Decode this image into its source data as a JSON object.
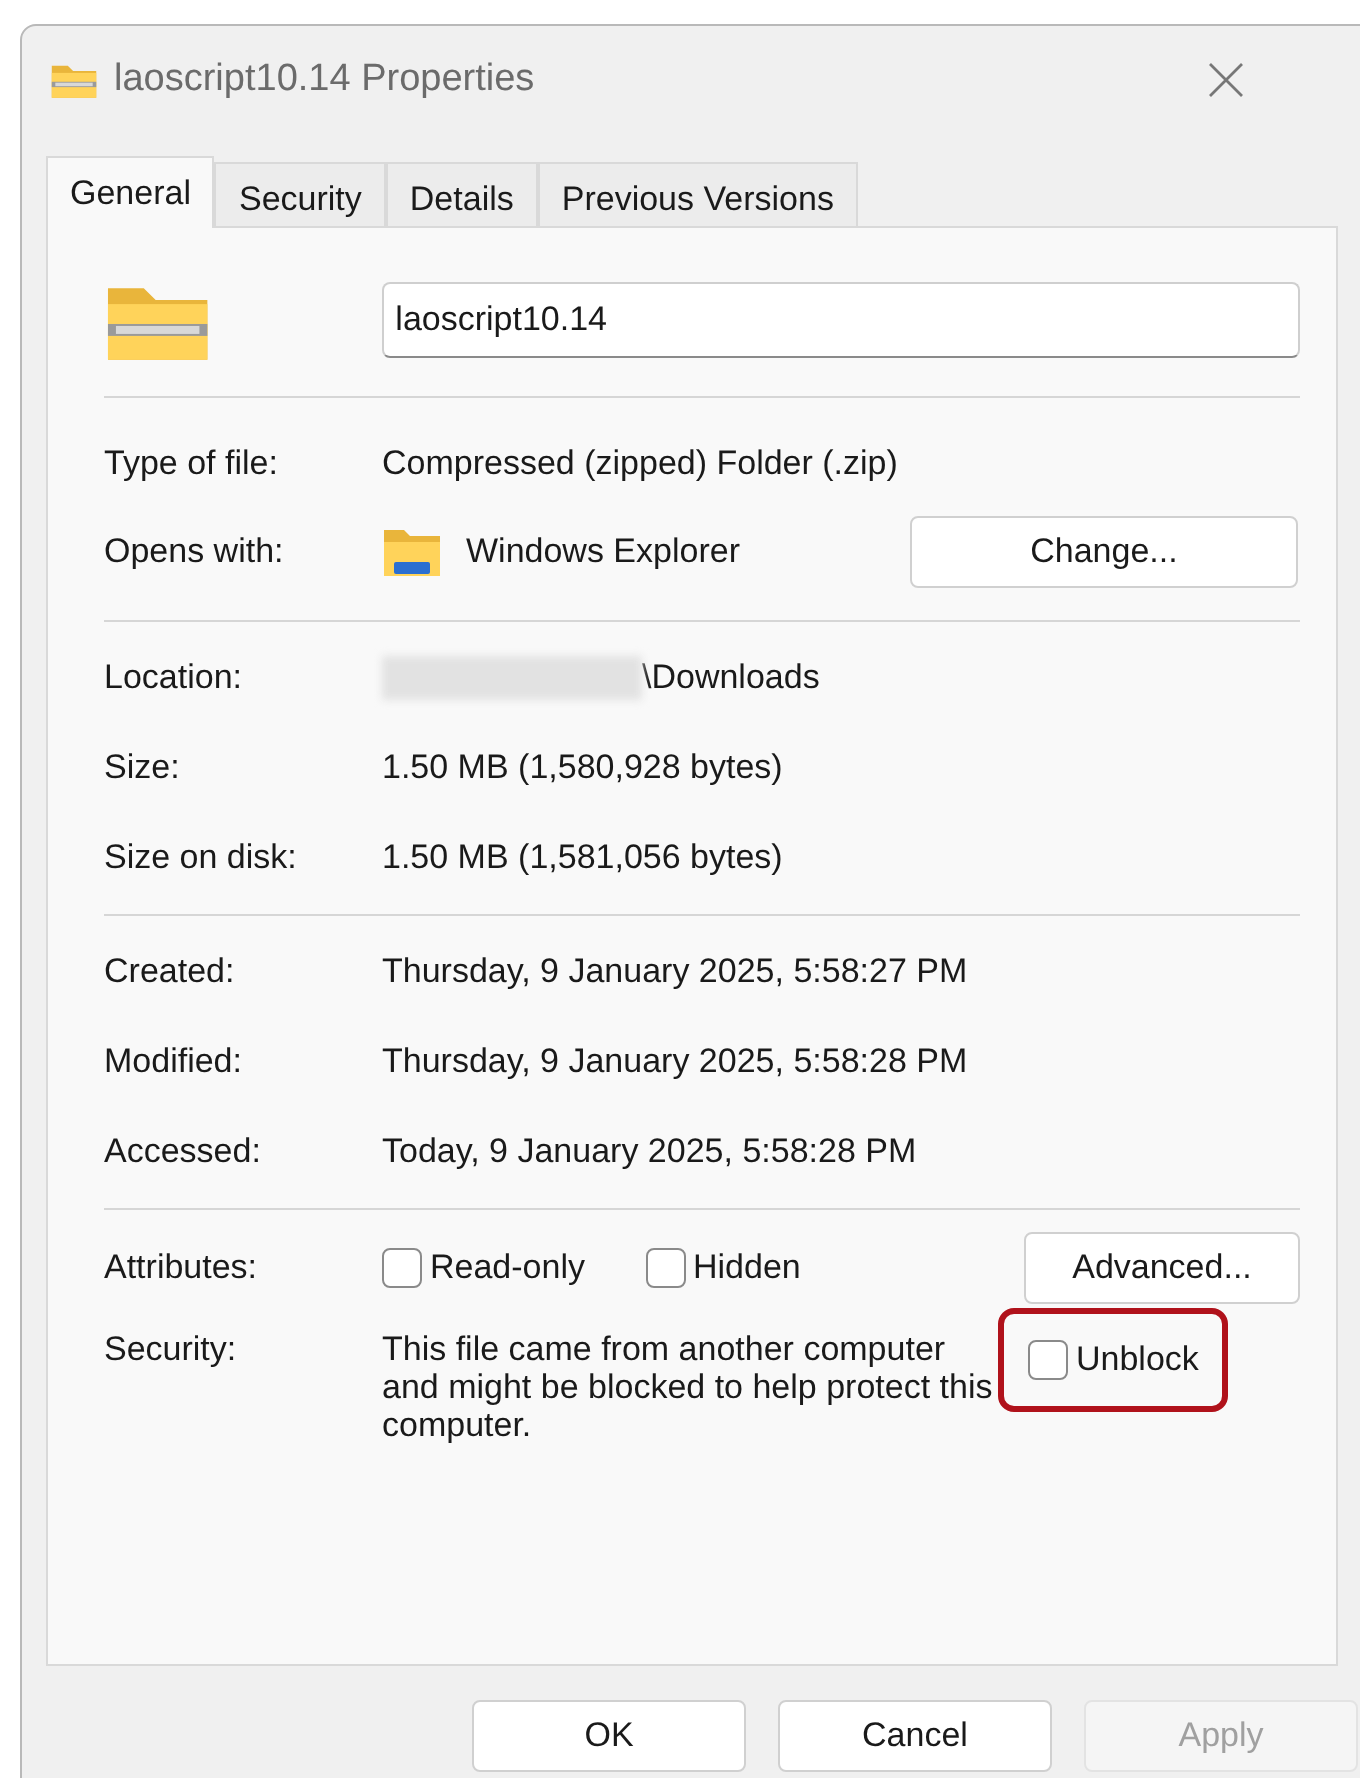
{
  "window": {
    "title": "laoscript10.14 Properties"
  },
  "tabs": [
    {
      "label": "General",
      "selected": true
    },
    {
      "label": "Security",
      "selected": false
    },
    {
      "label": "Details",
      "selected": false
    },
    {
      "label": "Previous Versions",
      "selected": false
    }
  ],
  "file_name": "laoscript10.14",
  "type_row": {
    "label": "Type of file:",
    "value": "Compressed (zipped) Folder (.zip)"
  },
  "opens_with": {
    "label": "Opens with:",
    "value": "Windows Explorer",
    "button": "Change..."
  },
  "location": {
    "label": "Location:",
    "value": "\\Downloads",
    "redacted": true
  },
  "sizes": [
    {
      "label": "Size:",
      "value": "1.50 MB (1,580,928 bytes)"
    },
    {
      "label": "Size on disk:",
      "value": "1.50 MB (1,581,056 bytes)"
    }
  ],
  "dates": [
    {
      "label": "Created:",
      "value": "Thursday, 9 January 2025, 5:58:27 PM"
    },
    {
      "label": "Modified:",
      "value": "Thursday, 9 January 2025, 5:58:28 PM"
    },
    {
      "label": "Accessed:",
      "value": "Today, 9 January 2025, 5:58:28 PM"
    }
  ],
  "attributes": {
    "label": "Attributes:",
    "options": [
      {
        "label": "Read-only",
        "checked": false
      },
      {
        "label": "Hidden",
        "checked": false
      }
    ],
    "button": "Advanced..."
  },
  "security": {
    "label": "Security:",
    "text": "This file came from another computer and might be blocked to help protect this computer.",
    "unblock": {
      "label": "Unblock",
      "checked": false,
      "highlighted": true
    }
  },
  "buttons": [
    {
      "label": "OK",
      "disabled": false
    },
    {
      "label": "Cancel",
      "disabled": false
    },
    {
      "label": "Apply",
      "disabled": true
    }
  ]
}
